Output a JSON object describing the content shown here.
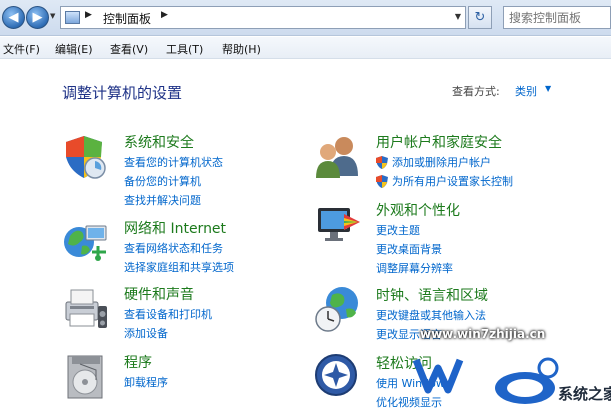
{
  "address_bar": {
    "breadcrumb": "控制面板",
    "search_placeholder": "搜索控制面板"
  },
  "menu": [
    {
      "label": "文件(F)"
    },
    {
      "label": "编辑(E)"
    },
    {
      "label": "查看(V)"
    },
    {
      "label": "工具(T)"
    },
    {
      "label": "帮助(H)"
    }
  ],
  "content": {
    "title": "调整计算机的设置",
    "view_by_label": "查看方式:",
    "view_by_value": "类别"
  },
  "categories": [
    {
      "title": "系统和安全",
      "icon": "system-security-icon",
      "links": [
        "查看您的计算机状态",
        "备份您的计算机",
        "查找并解决问题"
      ]
    },
    {
      "title": "网络和 Internet",
      "icon": "network-internet-icon",
      "links": [
        "查看网络状态和任务",
        "选择家庭组和共享选项"
      ]
    },
    {
      "title": "硬件和声音",
      "icon": "hardware-sound-icon",
      "links": [
        "查看设备和打印机",
        "添加设备"
      ]
    },
    {
      "title": "程序",
      "icon": "programs-icon",
      "links": [
        "卸载程序"
      ]
    },
    {
      "title": "用户帐户和家庭安全",
      "icon": "user-accounts-icon",
      "links": [
        "添加或删除用户帐户",
        "为所有用户设置家长控制"
      ]
    },
    {
      "title": "外观和个性化",
      "icon": "appearance-icon",
      "links": [
        "更改主题",
        "更改桌面背景",
        "调整屏幕分辨率"
      ]
    },
    {
      "title": "时钟、语言和区域",
      "icon": "clock-language-region-icon",
      "links": [
        "更改键盘或其他输入法",
        "更改显示语言"
      ]
    },
    {
      "title": "轻松访问",
      "icon": "ease-of-access-icon",
      "links": [
        "使用 Windows",
        "优化视频显示"
      ]
    }
  ],
  "watermark": {
    "url": "www.win7zhijia.cn",
    "brand": "系统之家"
  }
}
